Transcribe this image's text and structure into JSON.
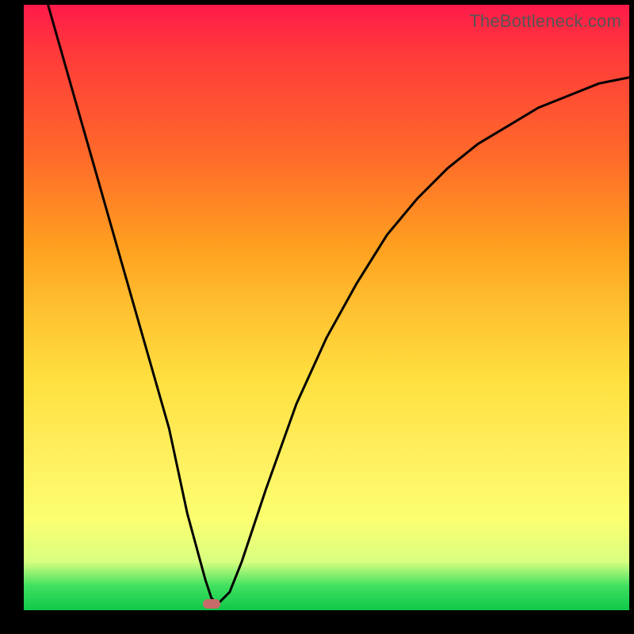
{
  "watermark": "TheBottleneck.com",
  "chart_data": {
    "type": "line",
    "title": "",
    "xlabel": "",
    "ylabel": "",
    "xlim": [
      0,
      100
    ],
    "ylim": [
      0,
      100
    ],
    "series": [
      {
        "name": "curve",
        "x": [
          4,
          8,
          12,
          16,
          20,
          24,
          27,
          30,
          31,
          32,
          34,
          36,
          40,
          45,
          50,
          55,
          60,
          65,
          70,
          75,
          80,
          85,
          90,
          95,
          100
        ],
        "y": [
          100,
          86,
          72,
          58,
          44,
          30,
          16,
          5,
          2,
          1,
          3,
          8,
          20,
          34,
          45,
          54,
          62,
          68,
          73,
          77,
          80,
          83,
          85,
          87,
          88
        ]
      }
    ],
    "marker": {
      "x": 31,
      "y": 1,
      "color": "#c86a6a"
    },
    "gradient_colors": {
      "top": "#ff1a4a",
      "mid1": "#ffa020",
      "mid2": "#fff060",
      "bottom": "#10c84a"
    }
  }
}
